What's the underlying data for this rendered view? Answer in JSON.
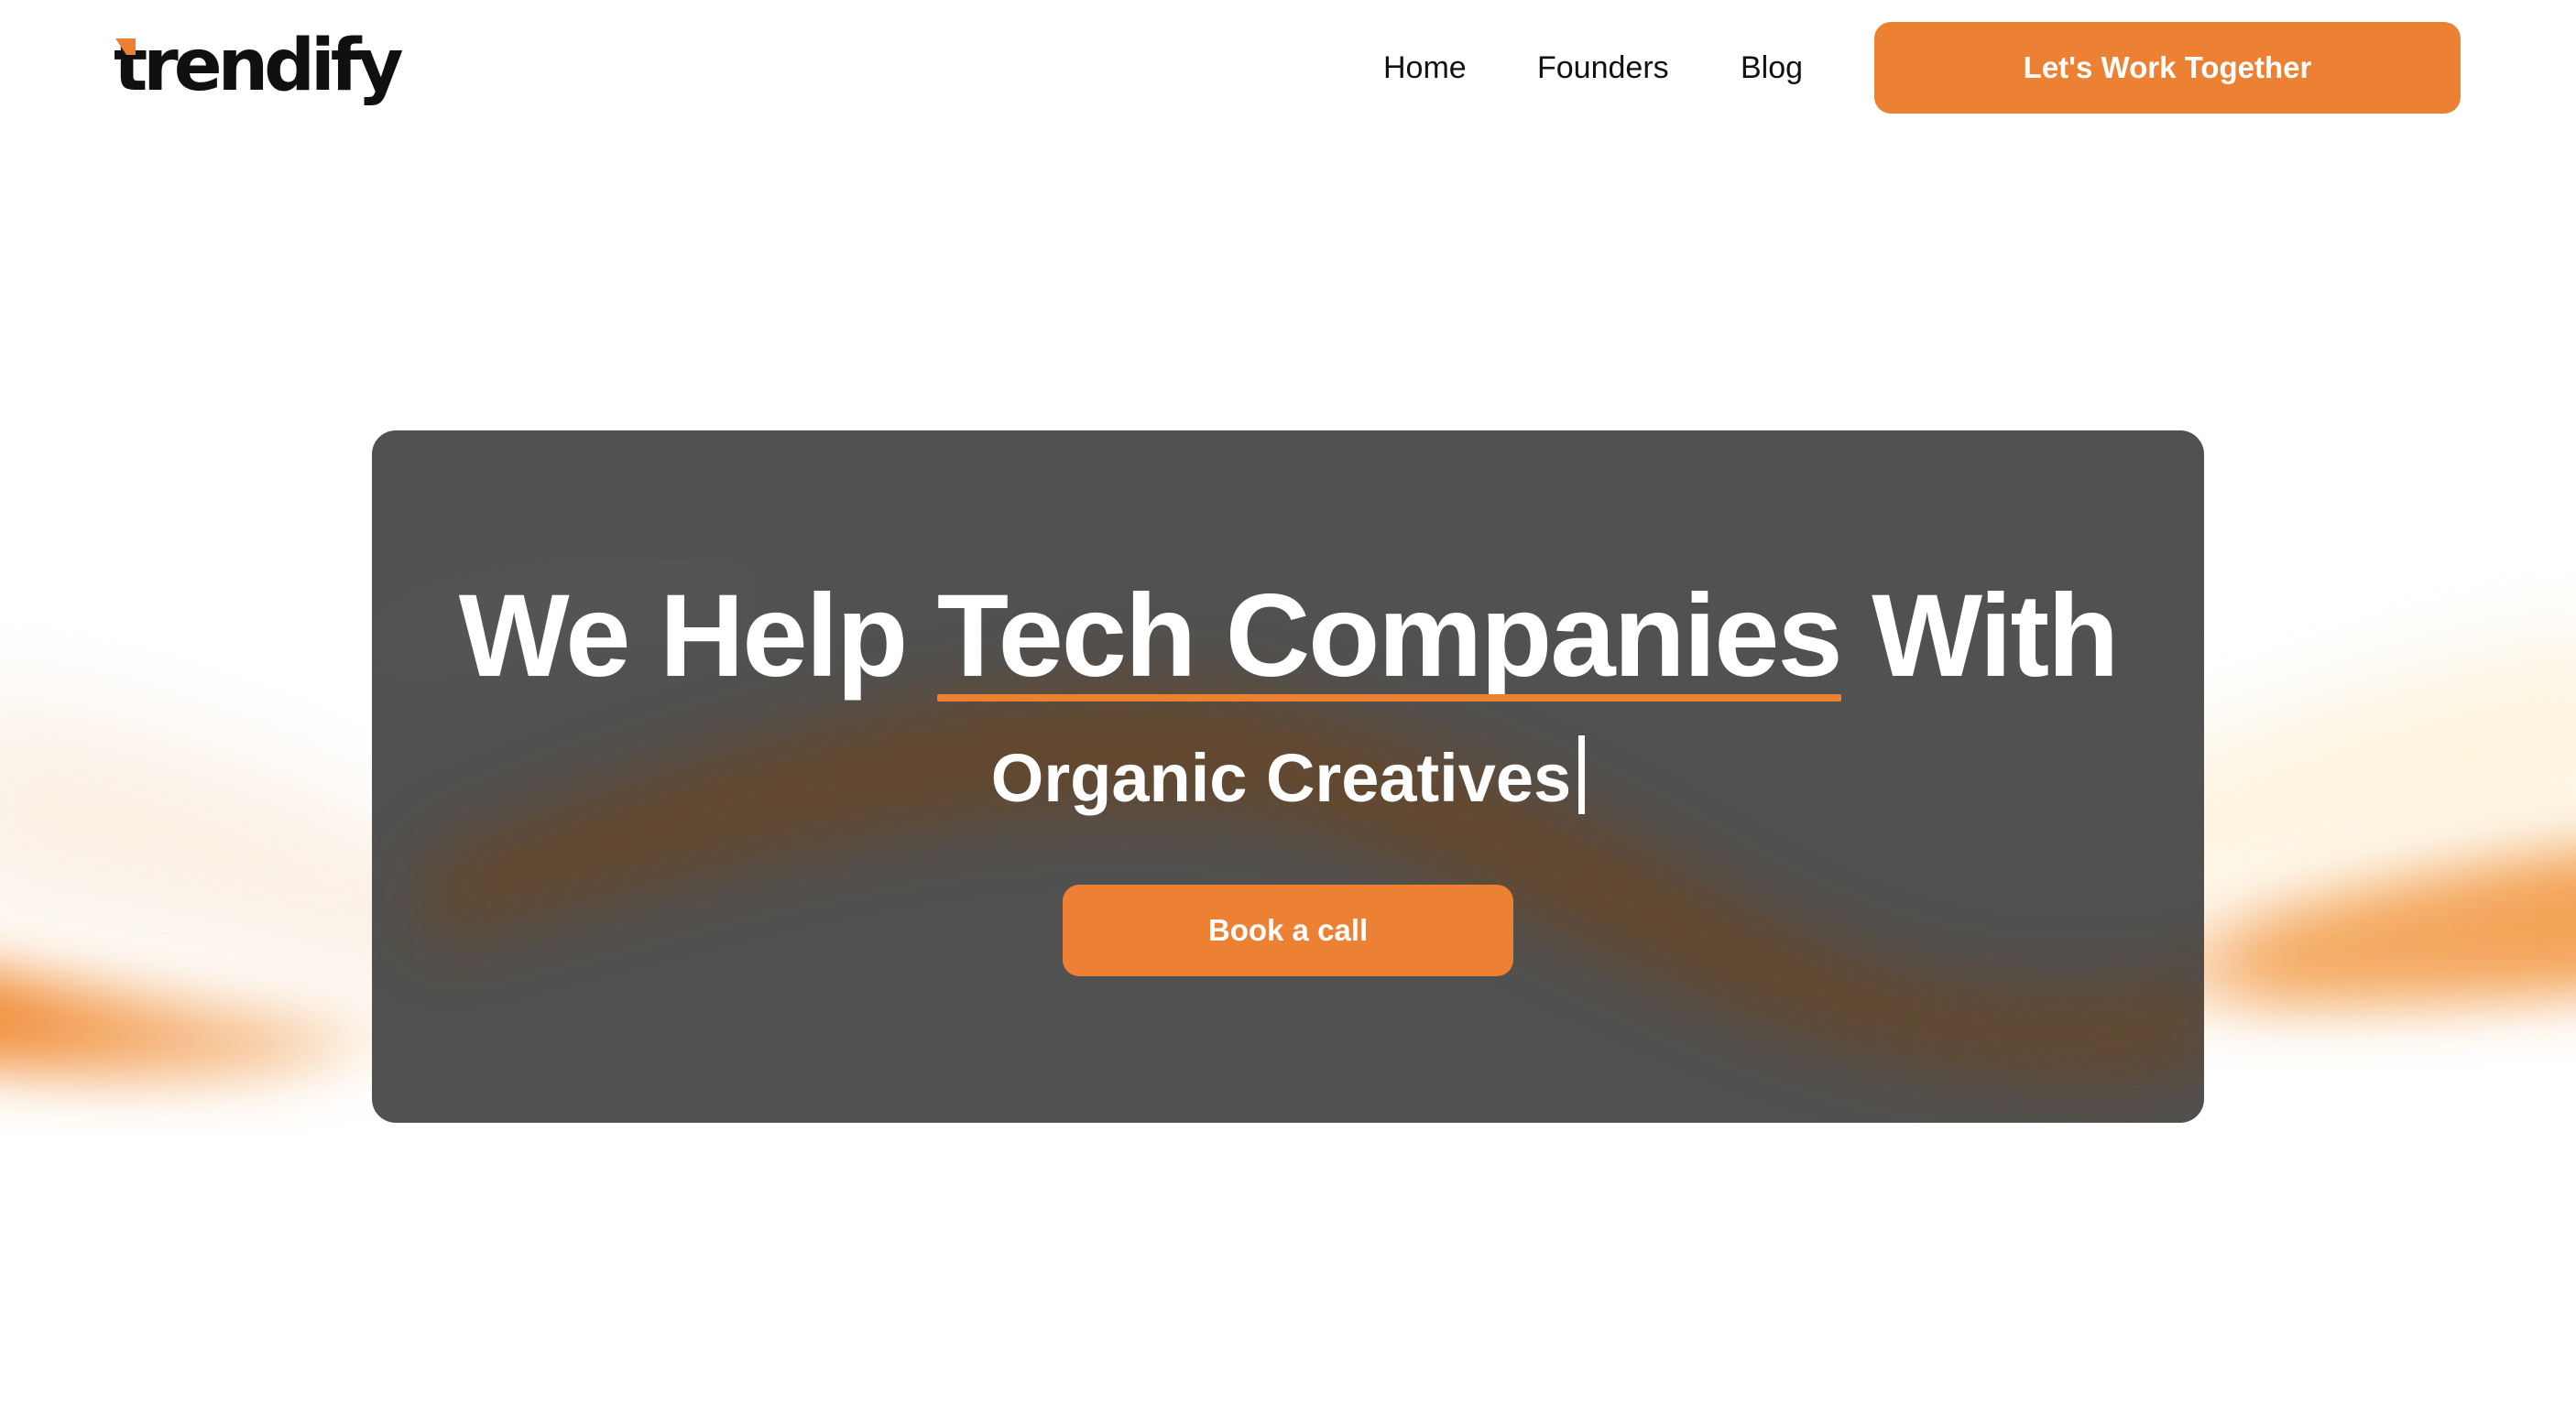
{
  "brand": {
    "logo_text": "trendify",
    "accent_color": "#ed8133",
    "card_color": "#444444",
    "text_color": "#111111"
  },
  "header": {
    "nav": [
      {
        "label": "Home"
      },
      {
        "label": "Founders"
      },
      {
        "label": "Blog"
      }
    ],
    "cta_label": "Let's Work Together"
  },
  "hero": {
    "headline_before": "We Help",
    "headline_highlight": "Tech Companies",
    "headline_after": "With",
    "subline": "Organic Creatives",
    "cta_label": "Book a call"
  }
}
